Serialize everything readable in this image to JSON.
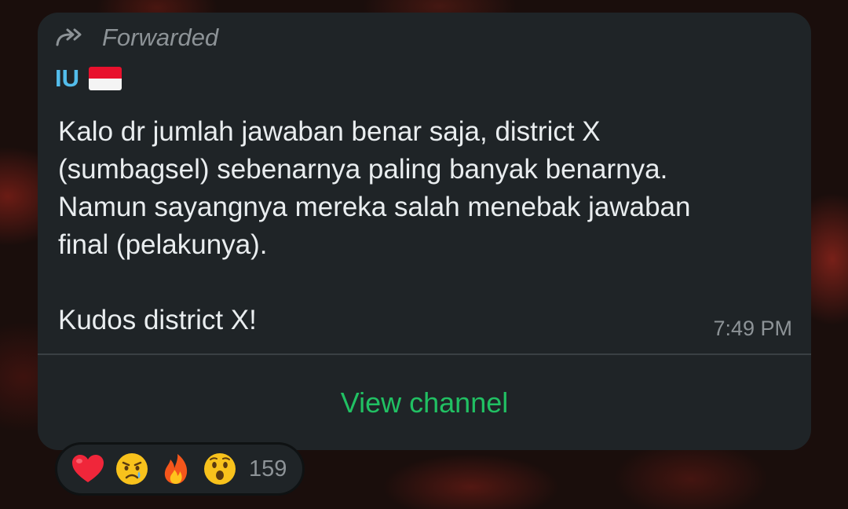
{
  "message": {
    "forwarded_label": "Forwarded",
    "sender_name": "IU",
    "sender_flag": "indonesia-flag",
    "text_lines": [
      "Kalo dr jumlah jawaban benar saja, district X",
      "(sumbagsel) sebenarnya paling banyak benarnya.",
      "Namun sayangnya mereka salah menebak jawaban",
      "final (pelakunya)."
    ],
    "text_closing": "Kudos district X!",
    "time": "7:49 PM",
    "view_channel_label": "View channel"
  },
  "reactions": {
    "emojis": [
      "red-heart",
      "crying-face",
      "fire",
      "surprised-face"
    ],
    "count": "159"
  },
  "colors": {
    "bubble": "#1f2427",
    "sender": "#53bdeb",
    "action": "#21c063",
    "text": "#e9edef",
    "meta": "#8d9397"
  }
}
